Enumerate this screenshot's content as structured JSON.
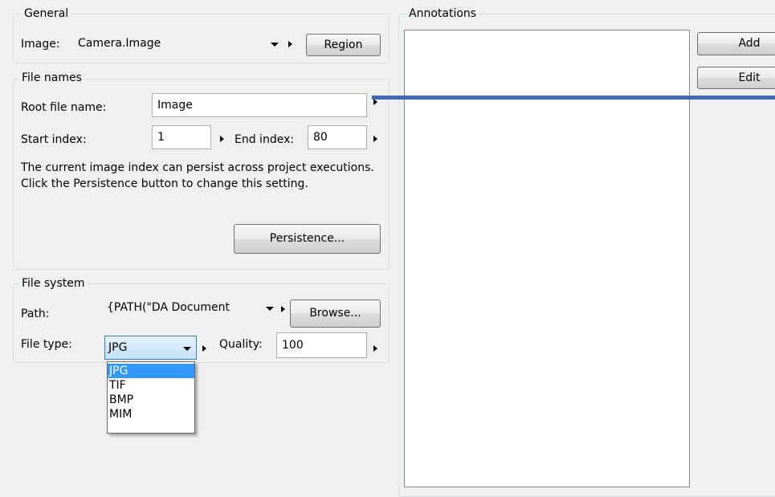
{
  "general": {
    "title": "General",
    "image_label": "Image:",
    "image_value": "Camera.Image",
    "region_button": "Region"
  },
  "file_names": {
    "title": "File names",
    "root_label": "Root file name:",
    "root_value": "Image",
    "start_label": "Start index:",
    "start_value": "1",
    "end_label": "End index:",
    "end_value": "80",
    "description": "The current image index can persist across project executions. Click the Persistence button to change this setting.",
    "persistence_button": "Persistence..."
  },
  "file_system": {
    "title": "File system",
    "path_label": "Path:",
    "path_value": "{PATH(\"DA Document",
    "browse_button": "Browse...",
    "type_label": "File type:",
    "type_value": "JPG",
    "quality_label": "Quality:",
    "quality_value": "100",
    "type_options": [
      "JPG",
      "TIF",
      "BMP",
      "MIM"
    ],
    "selected_index": 0
  },
  "annotations": {
    "title": "Annotations",
    "add_button": "Add",
    "edit_button": "Edit"
  },
  "colors": {
    "connector_line": "#4169b5",
    "selection": "#3399ff",
    "combo_selected": "#c9e3f7"
  }
}
